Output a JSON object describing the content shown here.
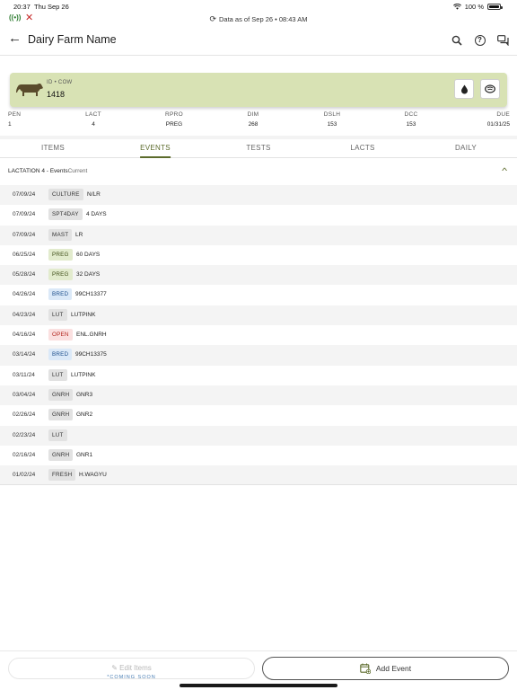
{
  "status_bar": {
    "time": "20:37",
    "date": "Thu Sep 26",
    "battery": "100 %"
  },
  "sync": {
    "text": "Data as of Sep 26 • 08:43 AM"
  },
  "header": {
    "title": "Dairy Farm Name"
  },
  "animal": {
    "subtitle": "ID • COW",
    "id": "1418"
  },
  "stats": [
    {
      "label": "PEN",
      "value": "1"
    },
    {
      "label": "LACT",
      "value": "4"
    },
    {
      "label": "RPRO",
      "value": "PREG"
    },
    {
      "label": "DIM",
      "value": "268"
    },
    {
      "label": "DSLH",
      "value": "153"
    },
    {
      "label": "DCC",
      "value": "153"
    },
    {
      "label": "DUE",
      "value": "01/31/25"
    }
  ],
  "tabs": [
    {
      "label": "ITEMS"
    },
    {
      "label": "EVENTS",
      "active": true
    },
    {
      "label": "TESTS"
    },
    {
      "label": "LACTS"
    },
    {
      "label": "DAILY"
    }
  ],
  "lactation": {
    "title": "LACTATION 4 - Events",
    "tag": "Current"
  },
  "events": [
    {
      "date": "07/09/24",
      "type": "CULTURE",
      "detail": "N/LR",
      "color": "gray"
    },
    {
      "date": "07/09/24",
      "type": "SPT4DAY",
      "detail": "4 DAYS",
      "color": "gray"
    },
    {
      "date": "07/09/24",
      "type": "MAST",
      "detail": "LR",
      "color": "gray"
    },
    {
      "date": "06/25/24",
      "type": "PREG",
      "detail": "60 DAYS",
      "color": "green"
    },
    {
      "date": "05/28/24",
      "type": "PREG",
      "detail": "32 DAYS",
      "color": "green"
    },
    {
      "date": "04/26/24",
      "type": "BRED",
      "detail": "99CH13377",
      "color": "blue"
    },
    {
      "date": "04/23/24",
      "type": "LUT",
      "detail": "LUTPINK",
      "color": "gray"
    },
    {
      "date": "04/16/24",
      "type": "OPEN",
      "detail": "ENL.GNRH",
      "color": "red"
    },
    {
      "date": "03/14/24",
      "type": "BRED",
      "detail": "99CH13375",
      "color": "blue"
    },
    {
      "date": "03/11/24",
      "type": "LUT",
      "detail": "LUTPINK",
      "color": "gray"
    },
    {
      "date": "03/04/24",
      "type": "GNRH",
      "detail": "GNR3",
      "color": "gray"
    },
    {
      "date": "02/26/24",
      "type": "GNRH",
      "detail": "GNR2",
      "color": "gray"
    },
    {
      "date": "02/23/24",
      "type": "LUT",
      "detail": "",
      "color": "gray"
    },
    {
      "date": "02/16/24",
      "type": "GNRH",
      "detail": "GNR1",
      "color": "gray"
    },
    {
      "date": "01/02/24",
      "type": "FRESH",
      "detail": "H.WAGYU",
      "color": "gray"
    }
  ],
  "footer": {
    "edit_label": "Edit Items",
    "edit_note": "*COMING SOON",
    "add_label": "Add Event"
  },
  "colors": {
    "accent": "#5c6b2c",
    "card_bg": "#d8e2b4",
    "badge_green": "#e2ebcd",
    "badge_blue": "#dbe9f8",
    "badge_red": "#fbe0e0",
    "badge_gray": "#e2e2e2"
  }
}
